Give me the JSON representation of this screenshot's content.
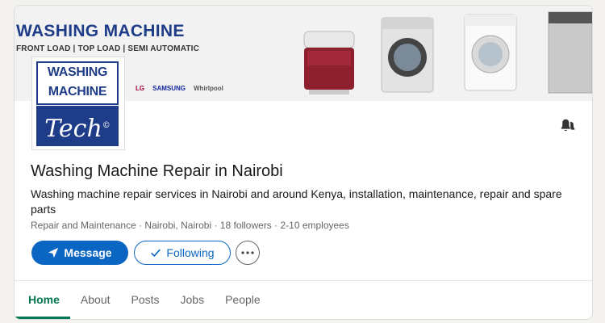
{
  "banner": {
    "title": "WASHING MACHINE",
    "subtitle": "FRONT LOAD | TOP LOAD | SEMI AUTOMATIC",
    "brands": [
      "LG",
      "SAMSUNG",
      "Whirlpool"
    ]
  },
  "logo": {
    "line1": "WASHING",
    "line2": "MACHINE",
    "script": "Tech",
    "mark": "©"
  },
  "company": {
    "name": "Washing Machine Repair in Nairobi",
    "tagline": "Washing machine repair services in Nairobi and around Kenya, installation, maintenance, repair and spare parts",
    "meta": "Repair and Maintenance · Nairobi, Nairobi · 18 followers · 2-10 employees"
  },
  "actions": {
    "message_label": "Message",
    "following_label": "Following"
  },
  "tabs": [
    {
      "label": "Home",
      "active": true
    },
    {
      "label": "About",
      "active": false
    },
    {
      "label": "Posts",
      "active": false
    },
    {
      "label": "Jobs",
      "active": false
    },
    {
      "label": "People",
      "active": false
    }
  ],
  "colors": {
    "primary": "#0a66c2",
    "active_tab": "#01754f",
    "logo_blue": "#1f3c88"
  },
  "icons": {
    "message": "send-icon",
    "following": "checkmark-icon",
    "more": "ellipsis-icon",
    "notifications": "bell-icon"
  }
}
